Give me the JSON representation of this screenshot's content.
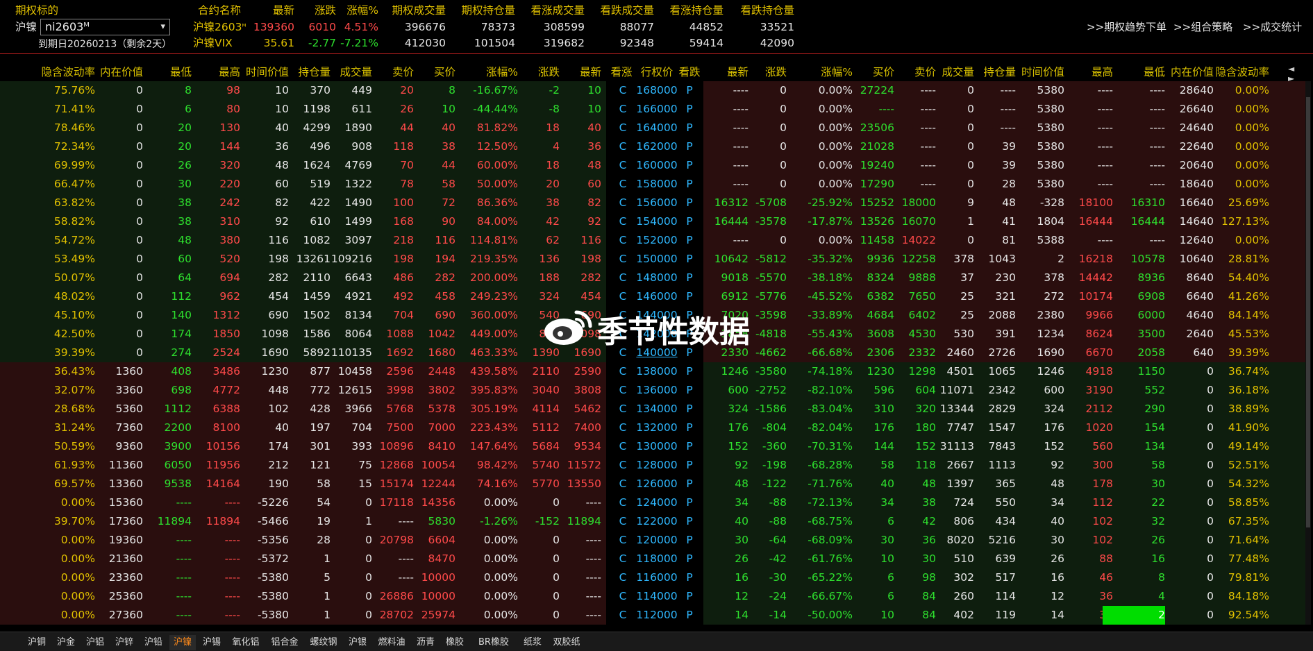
{
  "header": {
    "underlying_label": "期权标的",
    "exchange_name": "沪镍",
    "contract_selected": "ni2603ᴹ",
    "expiry_text": "到期日20260213（剩余2天）",
    "columns": [
      "合约名称",
      "最新",
      "涨跌",
      "涨幅%",
      "期权成交量",
      "期权持仓量",
      "看涨成交量",
      "看跌成交量",
      "看涨持仓量",
      "看跌持仓量"
    ],
    "rows": [
      {
        "name": "沪镍2603",
        "name_sup": "ᴹ",
        "latest": "139360",
        "change": "6010",
        "pct": "4.51%",
        "opt_vol": "396676",
        "opt_oi": "78373",
        "call_vol": "308599",
        "put_vol": "88077",
        "call_oi": "44852",
        "put_oi": "33521"
      },
      {
        "name": "沪镍VIX",
        "name_sup": "",
        "latest": "35.61",
        "change": "-2.77",
        "pct": "-7.21%",
        "opt_vol": "412030",
        "opt_oi": "101504",
        "call_vol": "319682",
        "put_vol": "92348",
        "call_oi": "59414",
        "put_oi": "42090"
      }
    ],
    "buttons": [
      ">>期权趋势下单",
      ">>组合策略",
      ">>成交统计"
    ]
  },
  "table_headers": [
    "隐含波动率",
    "内在价值",
    "最低",
    "最高",
    "时间价值",
    "持仓量",
    "成交量",
    "卖价",
    "买价",
    "涨幅%",
    "涨跌",
    "最新",
    "看涨",
    "行权价",
    "看跌",
    "最新",
    "涨跌",
    "涨幅%",
    "买价",
    "卖价",
    "成交量",
    "持仓量",
    "时间价值",
    "最高",
    "最低",
    "内在价值",
    "隐含波动率"
  ],
  "nav_arrows": "◄ ►",
  "rows": [
    {
      "c": [
        "75.76%",
        "0",
        "8",
        "98",
        "10",
        "370",
        "449",
        "20",
        "8",
        "-16.67%",
        "-2",
        "10"
      ],
      "k": "168000",
      "p": [
        "----",
        "0",
        "0.00%",
        "27224",
        "----",
        "0",
        "----",
        "5380",
        "----",
        "----",
        "28640",
        "0.00%"
      ]
    },
    {
      "c": [
        "71.41%",
        "0",
        "6",
        "80",
        "10",
        "1198",
        "611",
        "26",
        "10",
        "-44.44%",
        "-8",
        "10"
      ],
      "k": "166000",
      "p": [
        "----",
        "0",
        "0.00%",
        "----",
        "----",
        "0",
        "----",
        "5380",
        "----",
        "----",
        "26640",
        "0.00%"
      ]
    },
    {
      "c": [
        "78.46%",
        "0",
        "20",
        "130",
        "40",
        "4299",
        "1890",
        "44",
        "40",
        "81.82%",
        "18",
        "40"
      ],
      "k": "164000",
      "p": [
        "----",
        "0",
        "0.00%",
        "23506",
        "----",
        "0",
        "----",
        "5380",
        "----",
        "----",
        "24640",
        "0.00%"
      ]
    },
    {
      "c": [
        "72.34%",
        "0",
        "20",
        "144",
        "36",
        "496",
        "908",
        "118",
        "38",
        "12.50%",
        "4",
        "36"
      ],
      "k": "162000",
      "p": [
        "----",
        "0",
        "0.00%",
        "21028",
        "----",
        "0",
        "39",
        "5380",
        "----",
        "----",
        "22640",
        "0.00%"
      ]
    },
    {
      "c": [
        "69.99%",
        "0",
        "26",
        "320",
        "48",
        "1624",
        "4769",
        "70",
        "44",
        "60.00%",
        "18",
        "48"
      ],
      "k": "160000",
      "p": [
        "----",
        "0",
        "0.00%",
        "19240",
        "----",
        "0",
        "39",
        "5380",
        "----",
        "----",
        "20640",
        "0.00%"
      ]
    },
    {
      "c": [
        "66.47%",
        "0",
        "30",
        "220",
        "60",
        "519",
        "1322",
        "78",
        "58",
        "50.00%",
        "20",
        "60"
      ],
      "k": "158000",
      "p": [
        "----",
        "0",
        "0.00%",
        "17290",
        "----",
        "0",
        "28",
        "5380",
        "----",
        "----",
        "18640",
        "0.00%"
      ]
    },
    {
      "c": [
        "63.82%",
        "0",
        "38",
        "242",
        "82",
        "422",
        "1490",
        "100",
        "72",
        "86.36%",
        "38",
        "82"
      ],
      "k": "156000",
      "p": [
        "16312",
        "-5708",
        "-25.92%",
        "15252",
        "18000",
        "9",
        "48",
        "-328",
        "18100",
        "16310",
        "16640",
        "25.69%"
      ]
    },
    {
      "c": [
        "58.82%",
        "0",
        "38",
        "310",
        "92",
        "610",
        "1499",
        "168",
        "90",
        "84.00%",
        "42",
        "92"
      ],
      "k": "154000",
      "p": [
        "16444",
        "-3578",
        "-17.87%",
        "13526",
        "16070",
        "1",
        "41",
        "1804",
        "16444",
        "16444",
        "14640",
        "127.13%"
      ]
    },
    {
      "c": [
        "54.72%",
        "0",
        "48",
        "380",
        "116",
        "1082",
        "3097",
        "218",
        "116",
        "114.81%",
        "62",
        "116"
      ],
      "k": "152000",
      "p": [
        "----",
        "0",
        "0.00%",
        "11458",
        "14022",
        "0",
        "81",
        "5388",
        "----",
        "----",
        "12640",
        "0.00%"
      ]
    },
    {
      "c": [
        "53.49%",
        "0",
        "60",
        "520",
        "198",
        "13261",
        "109216",
        "198",
        "194",
        "219.35%",
        "136",
        "198"
      ],
      "k": "150000",
      "p": [
        "10642",
        "-5812",
        "-35.32%",
        "9936",
        "12258",
        "378",
        "1043",
        "2",
        "16218",
        "10578",
        "10640",
        "28.81%"
      ]
    },
    {
      "c": [
        "50.07%",
        "0",
        "64",
        "694",
        "282",
        "2110",
        "6643",
        "486",
        "282",
        "200.00%",
        "188",
        "282"
      ],
      "k": "148000",
      "p": [
        "9018",
        "-5570",
        "-38.18%",
        "8324",
        "9888",
        "37",
        "230",
        "378",
        "14442",
        "8936",
        "8640",
        "54.40%"
      ]
    },
    {
      "c": [
        "48.02%",
        "0",
        "112",
        "962",
        "454",
        "1459",
        "4921",
        "492",
        "458",
        "249.23%",
        "324",
        "454"
      ],
      "k": "146000",
      "p": [
        "6912",
        "-5776",
        "-45.52%",
        "6382",
        "7650",
        "25",
        "321",
        "272",
        "10174",
        "6908",
        "6640",
        "41.26%"
      ]
    },
    {
      "c": [
        "45.10%",
        "0",
        "140",
        "1312",
        "690",
        "1502",
        "8134",
        "704",
        "690",
        "360.00%",
        "540",
        "690"
      ],
      "k": "144000",
      "p": [
        "7020",
        "-3598",
        "-33.89%",
        "4684",
        "6402",
        "25",
        "2088",
        "2380",
        "9966",
        "6000",
        "4640",
        "84.14%"
      ]
    },
    {
      "c": [
        "42.50%",
        "0",
        "174",
        "1850",
        "1098",
        "1586",
        "8064",
        "1088",
        "1042",
        "449.00%",
        "898",
        "1098"
      ],
      "k": "142000",
      "p": [
        "3858",
        "-4818",
        "-55.43%",
        "3608",
        "4530",
        "530",
        "391",
        "1234",
        "8624",
        "3500",
        "2640",
        "45.53%"
      ]
    },
    {
      "c": [
        "39.39%",
        "0",
        "274",
        "2524",
        "1690",
        "5892",
        "110135",
        "1692",
        "1680",
        "463.33%",
        "1390",
        "1690"
      ],
      "k": "140000",
      "p": [
        "2330",
        "-4662",
        "-66.68%",
        "2306",
        "2332",
        "2460",
        "2726",
        "1690",
        "6670",
        "2058",
        "640",
        "39.39%"
      ]
    },
    {
      "c": [
        "36.43%",
        "1360",
        "408",
        "3486",
        "1230",
        "877",
        "10458",
        "2596",
        "2448",
        "439.58%",
        "2110",
        "2590"
      ],
      "k": "138000",
      "p": [
        "1246",
        "-3580",
        "-74.18%",
        "1230",
        "1298",
        "4501",
        "1065",
        "1246",
        "4918",
        "1150",
        "0",
        "36.74%"
      ]
    },
    {
      "c": [
        "32.07%",
        "3360",
        "698",
        "4772",
        "448",
        "772",
        "12615",
        "3998",
        "3802",
        "395.83%",
        "3040",
        "3808"
      ],
      "k": "136000",
      "p": [
        "600",
        "-2752",
        "-82.10%",
        "596",
        "604",
        "11071",
        "2342",
        "600",
        "3190",
        "552",
        "0",
        "36.18%"
      ]
    },
    {
      "c": [
        "28.68%",
        "5360",
        "1112",
        "6388",
        "102",
        "428",
        "3966",
        "5768",
        "5378",
        "305.19%",
        "4114",
        "5462"
      ],
      "k": "134000",
      "p": [
        "324",
        "-1586",
        "-83.04%",
        "310",
        "320",
        "13344",
        "2829",
        "324",
        "2112",
        "290",
        "0",
        "38.89%"
      ]
    },
    {
      "c": [
        "31.24%",
        "7360",
        "2200",
        "8100",
        "40",
        "197",
        "704",
        "7500",
        "7000",
        "223.43%",
        "5112",
        "7400"
      ],
      "k": "132000",
      "p": [
        "176",
        "-804",
        "-82.04%",
        "176",
        "180",
        "7747",
        "1547",
        "176",
        "1020",
        "154",
        "0",
        "41.90%"
      ]
    },
    {
      "c": [
        "50.59%",
        "9360",
        "3900",
        "10156",
        "174",
        "301",
        "393",
        "10896",
        "8410",
        "147.64%",
        "5684",
        "9534"
      ],
      "k": "130000",
      "p": [
        "152",
        "-360",
        "-70.31%",
        "144",
        "152",
        "31113",
        "7843",
        "152",
        "560",
        "134",
        "0",
        "49.14%"
      ]
    },
    {
      "c": [
        "61.93%",
        "11360",
        "6050",
        "11956",
        "212",
        "121",
        "75",
        "12868",
        "10054",
        "98.42%",
        "5740",
        "11572"
      ],
      "k": "128000",
      "p": [
        "92",
        "-198",
        "-68.28%",
        "58",
        "118",
        "2667",
        "1113",
        "92",
        "300",
        "58",
        "0",
        "52.51%"
      ]
    },
    {
      "c": [
        "69.57%",
        "13360",
        "9538",
        "14164",
        "190",
        "58",
        "15",
        "15174",
        "12244",
        "74.16%",
        "5770",
        "13550"
      ],
      "k": "126000",
      "p": [
        "48",
        "-122",
        "-71.76%",
        "40",
        "48",
        "1397",
        "365",
        "48",
        "178",
        "30",
        "0",
        "54.32%"
      ]
    },
    {
      "c": [
        "0.00%",
        "15360",
        "----",
        "----",
        "-5226",
        "54",
        "0",
        "17118",
        "14356",
        "0.00%",
        "0",
        "----"
      ],
      "k": "124000",
      "p": [
        "34",
        "-88",
        "-72.13%",
        "34",
        "38",
        "724",
        "550",
        "34",
        "112",
        "22",
        "0",
        "58.85%"
      ]
    },
    {
      "c": [
        "39.70%",
        "17360",
        "11894",
        "11894",
        "-5466",
        "19",
        "1",
        "----",
        "5830",
        "-1.26%",
        "-152",
        "11894"
      ],
      "k": "122000",
      "p": [
        "40",
        "-88",
        "-68.75%",
        "6",
        "42",
        "806",
        "434",
        "40",
        "102",
        "32",
        "0",
        "67.35%"
      ]
    },
    {
      "c": [
        "0.00%",
        "19360",
        "----",
        "----",
        "-5356",
        "28",
        "0",
        "20798",
        "6604",
        "0.00%",
        "0",
        "----"
      ],
      "k": "120000",
      "p": [
        "30",
        "-64",
        "-68.09%",
        "30",
        "36",
        "8020",
        "5216",
        "30",
        "102",
        "26",
        "0",
        "71.64%"
      ]
    },
    {
      "c": [
        "0.00%",
        "21360",
        "----",
        "----",
        "-5372",
        "1",
        "0",
        "----",
        "8470",
        "0.00%",
        "0",
        "----"
      ],
      "k": "118000",
      "p": [
        "26",
        "-42",
        "-61.76%",
        "10",
        "30",
        "510",
        "639",
        "26",
        "88",
        "16",
        "0",
        "77.48%"
      ]
    },
    {
      "c": [
        "0.00%",
        "23360",
        "----",
        "----",
        "-5380",
        "5",
        "0",
        "----",
        "10000",
        "0.00%",
        "0",
        "----"
      ],
      "k": "116000",
      "p": [
        "16",
        "-30",
        "-65.22%",
        "6",
        "98",
        "302",
        "517",
        "16",
        "46",
        "8",
        "0",
        "79.81%"
      ]
    },
    {
      "c": [
        "0.00%",
        "25360",
        "----",
        "----",
        "-5380",
        "1",
        "0",
        "26886",
        "10000",
        "0.00%",
        "0",
        "----"
      ],
      "k": "114000",
      "p": [
        "12",
        "-24",
        "-66.67%",
        "6",
        "84",
        "260",
        "114",
        "12",
        "36",
        "4",
        "0",
        "84.18%"
      ]
    },
    {
      "c": [
        "0.00%",
        "27360",
        "----",
        "----",
        "-5380",
        "1",
        "0",
        "28702",
        "25974",
        "0.00%",
        "0",
        "----"
      ],
      "k": "112000",
      "p": [
        "14",
        "-14",
        "-50.00%",
        "10",
        "84",
        "402",
        "119",
        "14",
        "32",
        "2",
        "0",
        "92.54%"
      ]
    }
  ],
  "call_letter": "C",
  "put_letter": "P",
  "bottom_tabs": [
    "沪铜",
    "沪金",
    "沪铝",
    "沪锌",
    "沪铅",
    "沪镍",
    "沪锡",
    "氧化铝",
    "铝合金",
    "螺纹钢",
    "沪银",
    "燃料油",
    "沥青",
    "橡胶",
    "BR橡胶",
    "纸浆",
    "双胶纸"
  ],
  "active_tab": "沪镍",
  "watermark_text": "季节性数据",
  "colors": {
    "bg": "#000000",
    "header_text": "#d8c000",
    "up": "#ff4a4a",
    "down": "#2ee02e",
    "neutral": "#e6e6e6",
    "strike": "#2fb8ff",
    "itm_call_bg": "#0e1e0e",
    "otm_call_bg": "#2a0e0e",
    "highlight": "#00dd00"
  }
}
